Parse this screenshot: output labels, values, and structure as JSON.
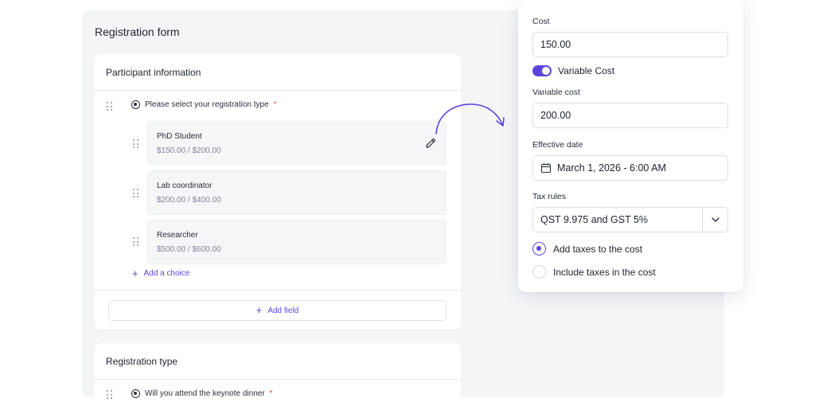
{
  "form": {
    "title": "Registration form"
  },
  "participant_card": {
    "title": "Participant information",
    "question": "Please select your registration type",
    "required_mark": "*",
    "choices": [
      {
        "name": "PhD Student",
        "price": "$150.00 / $200.00"
      },
      {
        "name": "Lab coordinator",
        "price": "$200.00 / $400.00"
      },
      {
        "name": "Researcher",
        "price": "$500.00 / $600.00"
      }
    ],
    "add_choice_label": "Add a choice",
    "add_field_label": "Add field"
  },
  "registration_card": {
    "title": "Registration type",
    "question": "Will you attend the keynote dinner",
    "required_mark": "*"
  },
  "popover": {
    "cost_label": "Cost",
    "cost_value": "150.00",
    "variable_cost_toggle_label": "Variable Cost",
    "variable_cost_enabled": true,
    "variable_cost_label": "Variable cost",
    "variable_cost_value": "200.00",
    "effective_date_label": "Effective date",
    "effective_date_value": "March 1, 2026 - 6:00 AM",
    "tax_rules_label": "Tax rules",
    "tax_rules_value": "QST 9.975 and GST 5%",
    "tax_options": [
      {
        "label": "Add taxes to the cost",
        "selected": true
      },
      {
        "label": "Include taxes in the cost",
        "selected": false
      }
    ]
  },
  "colors": {
    "accent": "#5b45d9",
    "required": "#e5484d",
    "panel_bg": "#f4f5f7"
  },
  "icons": [
    "drag-handle-icon",
    "radio-icon",
    "pencil-icon",
    "plus-icon",
    "calendar-icon",
    "chevron-down-icon",
    "curved-arrow-icon"
  ]
}
